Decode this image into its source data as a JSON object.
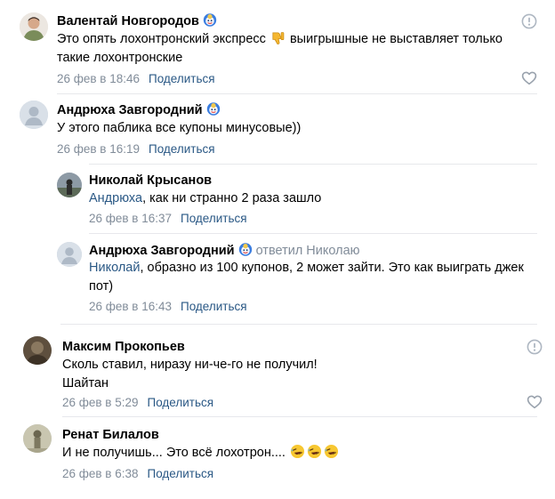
{
  "comments": [
    {
      "author": "Валентай Новгородов",
      "text_parts": [
        "Это опять лохонтронский экспресс ",
        " выигрышные не выставляет только такие лохонтронские"
      ],
      "date": "26 фев в 18:46",
      "share_label": "Поделиться"
    },
    {
      "author": "Андрюха Завгородний",
      "text": "У этого паблика все купоны минусовые))",
      "date": "26 фев в 16:19",
      "share_label": "Поделиться"
    },
    {
      "author": "Николай Крысанов",
      "mention": "Андрюха",
      "text": ", как ни странно 2 раза зашло",
      "date": "26 фев в 16:37",
      "share_label": "Поделиться"
    },
    {
      "author": "Андрюха Завгородний",
      "replied_to": "ответил Николаю",
      "mention": "Николай",
      "text": ", образно из 100 купонов, 2 может зайти. Это как выиграть джек пот)",
      "date": "26 фев в 16:43",
      "share_label": "Поделиться"
    },
    {
      "author": "Максим Прокопьев",
      "text_lines": [
        "Сколь ставил, ниразу ни-че-го не получил!",
        "Шайтан"
      ],
      "date": "26 фев в 5:29",
      "share_label": "Поделиться"
    },
    {
      "author": "Ренат Билалов",
      "text": "И не получишь... Это всё лохотрон.... ",
      "date": "26 фев в 6:38",
      "share_label": "Поделиться"
    }
  ],
  "icons": {
    "badge": "fan-badge-icon",
    "report": "report-icon",
    "like": "heart-icon",
    "thumbs_down": "thumbs-down-emoji",
    "laugh": "rofl-emoji"
  },
  "colors": {
    "name": "#000000",
    "link": "#2a5885",
    "meta": "#818c99",
    "divider": "#e7e8ec"
  }
}
